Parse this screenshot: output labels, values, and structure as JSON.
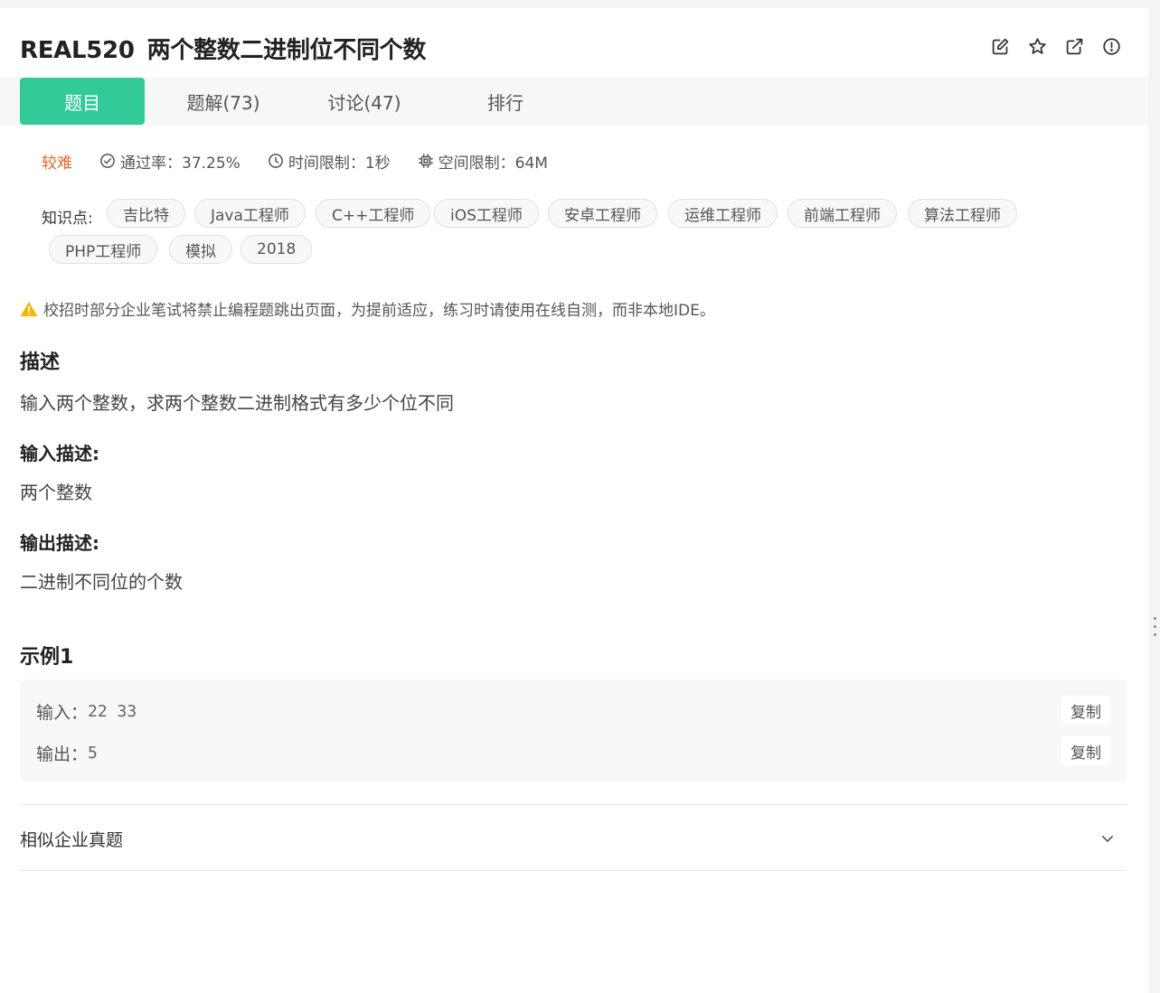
{
  "header": {
    "problem_id": "REAL520",
    "title": "两个整数二进制位不同个数",
    "icons": [
      "edit-icon",
      "star-icon",
      "external-link-icon",
      "report-icon"
    ]
  },
  "tabs": [
    {
      "label": "题目",
      "active": true
    },
    {
      "label": "题解(73)",
      "active": false
    },
    {
      "label": "讨论(47)",
      "active": false
    },
    {
      "label": "排行",
      "active": false
    }
  ],
  "meta": {
    "difficulty": "较难",
    "pass_rate": "通过率：37.25%",
    "time_limit": "时间限制：1秒",
    "memory_limit": "空间限制：64M"
  },
  "knowledge": {
    "label": "知识点:",
    "tags": [
      "吉比特",
      "Java工程师",
      "C++工程师",
      "iOS工程师",
      "安卓工程师",
      "运维工程师",
      "前端工程师",
      "算法工程师",
      "PHP工程师",
      "模拟",
      "2018"
    ]
  },
  "notice": "校招时部分企业笔试将禁止编程题跳出页面，为提前适应，练习时请使用在线自测，而非本地IDE。",
  "description": {
    "heading": "描述",
    "text": "输入两个整数，求两个整数二进制格式有多少个位不同"
  },
  "input_desc": {
    "heading": "输入描述:",
    "text": "两个整数"
  },
  "output_desc": {
    "heading": "输出描述:",
    "text": "二进制不同位的个数"
  },
  "example": {
    "heading": "示例1",
    "input_label": "输入：",
    "input_value": "22 33",
    "output_label": "输出：",
    "output_value": "5",
    "copy_label": "复制"
  },
  "similar": {
    "label": "相似企业真题"
  },
  "colors": {
    "accent": "#32ca99",
    "difficulty": "#e8662c",
    "warning": "#f5b800"
  }
}
